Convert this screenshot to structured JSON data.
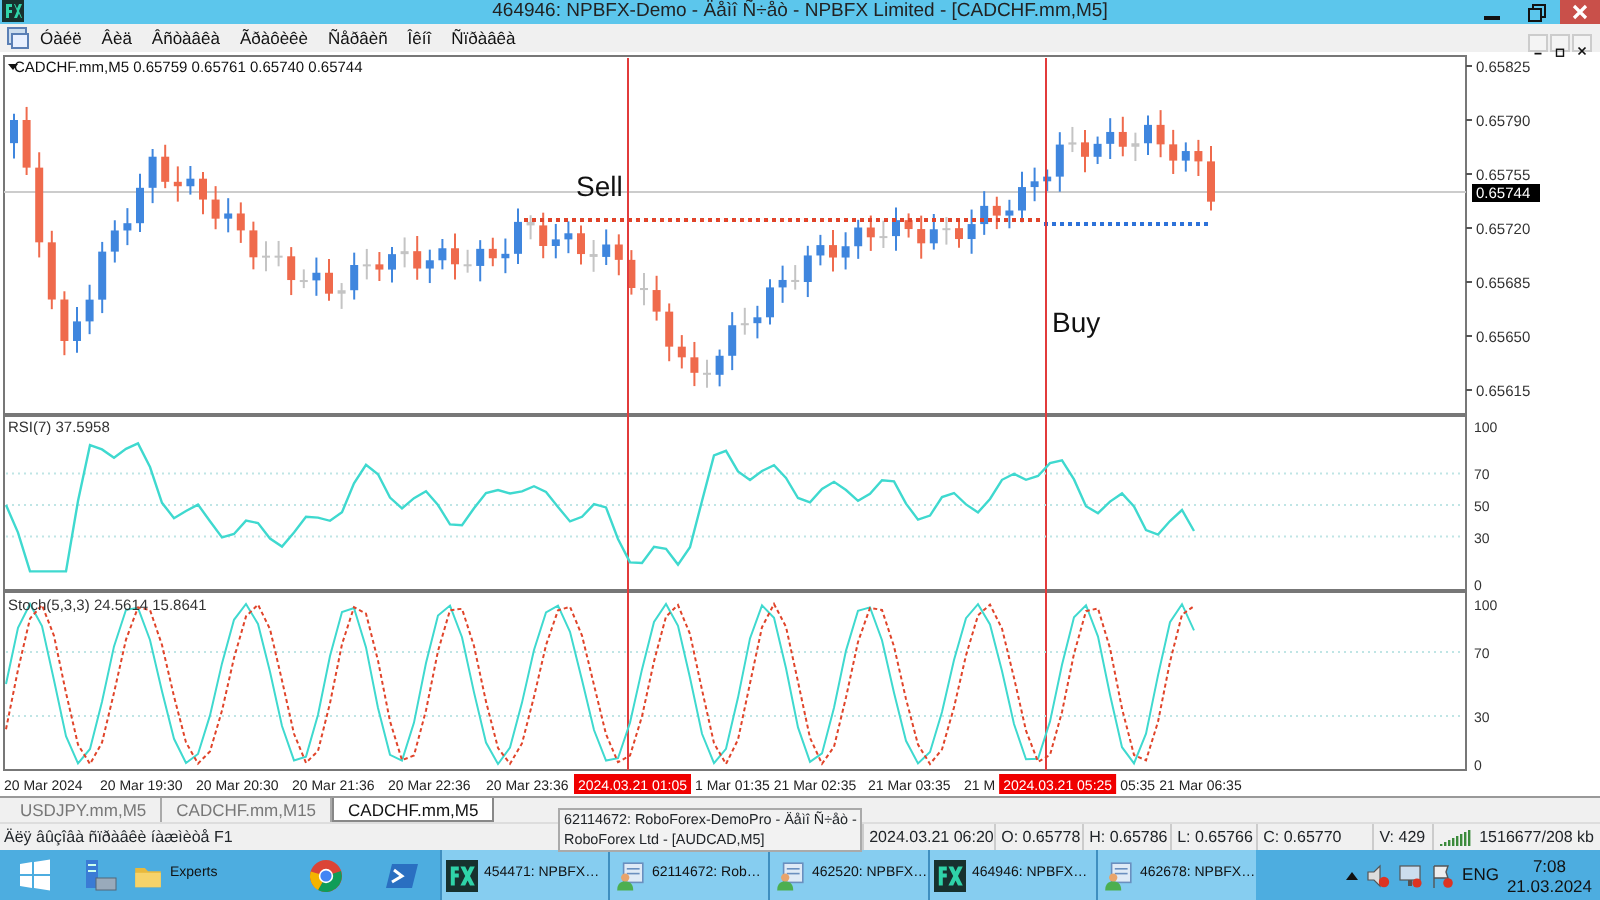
{
  "window": {
    "title": "464946: NPBFX-Demo - Äåìî Ñ÷åò - NPBFX Limited - [CADCHF.mm,M5]"
  },
  "menu": [
    "Óàéë",
    "Âèä",
    "Âñòàâêà",
    "Ãðàôèêè",
    "Ñåðâèñ",
    "Îêíî",
    "Ñïðàâêà"
  ],
  "chart": {
    "symbol": "CADCHF.mm,M5",
    "ohlc": "0.65759 0.65761 0.65740 0.65744",
    "price_ticks": [
      "0.65825",
      "0.65790",
      "0.65755",
      "0.65720",
      "0.65685",
      "0.65650",
      "0.65615"
    ],
    "current_price": "0.65744",
    "labels": [
      {
        "text": "Sell"
      },
      {
        "text": "Buy"
      }
    ],
    "time_ticks": [
      {
        "text": "20 Mar 2024",
        "highlight": false
      },
      {
        "text": "20 Mar 19:30",
        "highlight": false
      },
      {
        "text": "20 Mar 20:30",
        "highlight": false
      },
      {
        "text": "20 Mar 21:36",
        "highlight": false
      },
      {
        "text": "20 Mar 22:36",
        "highlight": false
      },
      {
        "text": "20 Mar 23:36",
        "highlight": false
      },
      {
        "text": "2024.03.21 01:05",
        "highlight": true
      },
      {
        "text": "1 Mar 01:35",
        "highlight": false
      },
      {
        "text": "21 Mar 02:35",
        "highlight": false
      },
      {
        "text": "21 Mar 03:35",
        "highlight": false
      },
      {
        "text": "21 M",
        "highlight": false
      },
      {
        "text": "2024.03.21 05:25",
        "highlight": true
      },
      {
        "text": "05:35",
        "highlight": false
      },
      {
        "text": "21 Mar 06:35",
        "highlight": false
      }
    ]
  },
  "rsi": {
    "legend": "RSI(7) 37.5958",
    "ticks": [
      "100",
      "70",
      "50",
      "30",
      "0"
    ]
  },
  "stoch": {
    "legend": "Stoch(5,3,3) 24.5614 15.8641",
    "ticks": [
      "100",
      "70",
      "30",
      "0"
    ]
  },
  "tabs": [
    {
      "label": "USDJPY.mm,M5",
      "selected": false
    },
    {
      "label": "CADCHF.mm,M15",
      "selected": false
    },
    {
      "label": "CADCHF.mm,M5",
      "selected": true
    }
  ],
  "status_bar": {
    "help": "Äëÿ âûçîâà ñïðàâêè íàæìèòå F1",
    "fields": [
      "2024.03.21 06:20",
      "O: 0.65778",
      "H: 0.65786",
      "L: 0.65766",
      "C: 0.65770",
      "V: 429",
      "1516677/208 kb"
    ]
  },
  "popup": {
    "lines": [
      "62114672: RoboForex-DemoPro - Äåìî Ñ÷åò -",
      "RoboForex Ltd - [AUDCAD,M5]"
    ]
  },
  "taskbar": {
    "items": [
      {
        "kind": "start"
      },
      {
        "kind": "server"
      },
      {
        "kind": "folder",
        "label": "Experts"
      },
      {
        "kind": "browser"
      },
      {
        "kind": "shell"
      },
      {
        "kind": "fx",
        "label": "454471: NPBFX…"
      },
      {
        "kind": "terminal",
        "label": "62114672: Rob…"
      },
      {
        "kind": "terminal",
        "label": "462520: NPBFX…"
      },
      {
        "kind": "fx",
        "label": "464946: NPBFX…"
      },
      {
        "kind": "terminal",
        "label": "462678: NPBFX…"
      }
    ],
    "language": "ENG",
    "time": "7:08",
    "date": "21.03.2024"
  }
}
